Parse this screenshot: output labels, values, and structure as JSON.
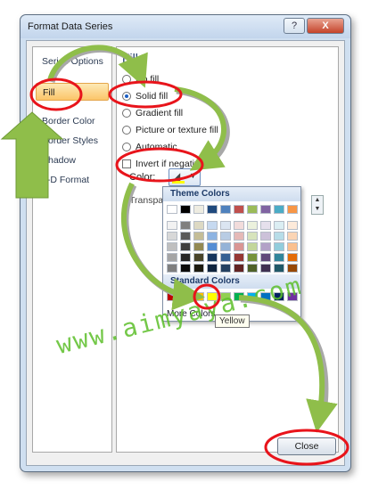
{
  "window": {
    "title": "Format Data Series",
    "help_label": "?",
    "close_label": "X"
  },
  "nav": {
    "items": [
      {
        "label": "Series Options",
        "name": "nav-item-series-options",
        "selected": false
      },
      {
        "label": "Fill",
        "name": "nav-item-fill",
        "selected": true
      },
      {
        "label": "Border Color",
        "name": "nav-item-border-color",
        "selected": false
      },
      {
        "label": "Border Styles",
        "name": "nav-item-border-styles",
        "selected": false
      },
      {
        "label": "Shadow",
        "name": "nav-item-shadow",
        "selected": false
      },
      {
        "label": "3-D Format",
        "name": "nav-item-3d-format",
        "selected": false
      }
    ]
  },
  "fill": {
    "heading": "Fill",
    "options": [
      {
        "label": "No fill",
        "type": "radio",
        "checked": false
      },
      {
        "label": "Solid fill",
        "type": "radio",
        "checked": true
      },
      {
        "label": "Gradient fill",
        "type": "radio",
        "checked": false
      },
      {
        "label": "Picture or texture fill",
        "type": "radio",
        "checked": false
      },
      {
        "label": "Automatic",
        "type": "radio",
        "checked": false
      },
      {
        "label": "Invert if negative",
        "type": "checkbox",
        "checked": false
      }
    ],
    "color_label": "Color:",
    "transparency_label": "Transparency:",
    "selected_color": "#ffff00"
  },
  "picker": {
    "theme_heading": "Theme Colors",
    "standard_heading": "Standard Colors",
    "more_label": "More Colors...",
    "tooltip": "Yellow",
    "theme_colors": [
      [
        "#ffffff",
        "#000000",
        "#eeece1",
        "#1f497d",
        "#4f81bd",
        "#c0504d",
        "#9bbb59",
        "#8064a2",
        "#4bacc6",
        "#f79646"
      ],
      [
        "#f2f2f2",
        "#7f7f7f",
        "#ddd9c3",
        "#c6d9f0",
        "#dbe5f1",
        "#f2dcdb",
        "#ebf1dd",
        "#e5e0ec",
        "#dbeef3",
        "#fdeada"
      ],
      [
        "#d8d8d8",
        "#595959",
        "#c4bd97",
        "#8db3e2",
        "#b8cce4",
        "#e5b9b7",
        "#d7e3bc",
        "#ccc1d9",
        "#b7dde8",
        "#fbd5b5"
      ],
      [
        "#bfbfbf",
        "#3f3f3f",
        "#938953",
        "#548dd4",
        "#95b3d7",
        "#d99694",
        "#c3d69b",
        "#b2a2c7",
        "#92cddc",
        "#fac08f"
      ],
      [
        "#a5a5a5",
        "#262626",
        "#494429",
        "#17365d",
        "#366092",
        "#953734",
        "#76923c",
        "#5f497a",
        "#31859b",
        "#e36c09"
      ],
      [
        "#7f7f7f",
        "#0c0c0c",
        "#1d1b10",
        "#0f243e",
        "#244061",
        "#632423",
        "#4f6128",
        "#3f3151",
        "#205867",
        "#974806"
      ]
    ],
    "standard_colors": [
      "#c00000",
      "#ff0000",
      "#ffc000",
      "#ffff00",
      "#92d050",
      "#00b050",
      "#00b0f0",
      "#0070c0",
      "#002060",
      "#7030a0"
    ]
  },
  "watermark": "www.aimyaya.com",
  "footer": {
    "close_label": "Close"
  },
  "annotation_colors": {
    "circle": "#e8141b",
    "arrow": "#8fbe4a",
    "arrow_shadow": "#a8a8a8"
  }
}
